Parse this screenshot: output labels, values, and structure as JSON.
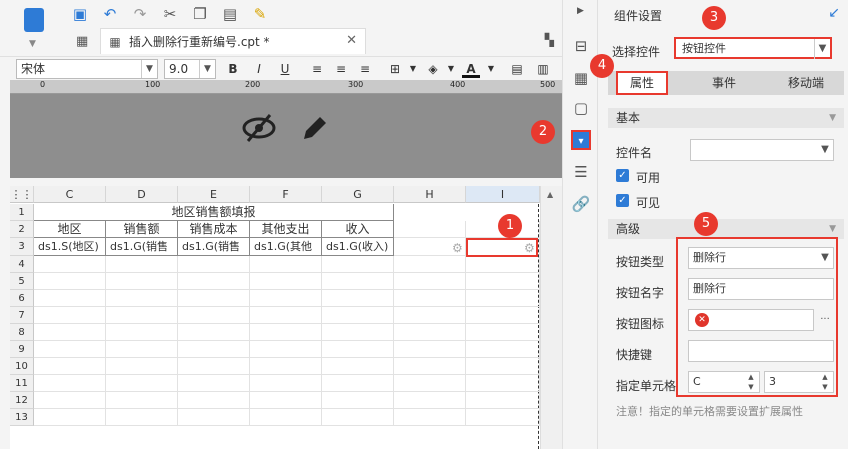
{
  "tab": {
    "filename": "插入删除行重新编号.cpt *"
  },
  "format": {
    "font": "宋体",
    "size": "9.0",
    "bold": "B",
    "italic": "I",
    "underline": "U",
    "font_color_glyph": "A"
  },
  "ruler": {
    "marks": [
      "0",
      "100",
      "200",
      "300",
      "400",
      "500"
    ]
  },
  "grid": {
    "columns": [
      "C",
      "D",
      "E",
      "F",
      "G",
      "H",
      "I"
    ],
    "rows": [
      "1",
      "2",
      "3",
      "4",
      "5",
      "6",
      "7",
      "8",
      "9",
      "10",
      "11",
      "12",
      "13"
    ],
    "title": "地区销售额填报",
    "headers": [
      "地区",
      "销售额",
      "销售成本",
      "其他支出",
      "收入"
    ],
    "data_row": [
      "ds1.S(地区)",
      "ds1.G(销售",
      "ds1.G(销售",
      "ds1.G(其他",
      "ds1.G(收入)"
    ]
  },
  "panel": {
    "title": "组件设置",
    "select_label": "选择控件",
    "select_value": "按钮控件",
    "tabs": [
      "属性",
      "事件",
      "移动端"
    ],
    "basic": {
      "section": "基本",
      "name_label": "控件名",
      "enabled": "可用",
      "visible": "可见"
    },
    "advanced": {
      "section": "高级",
      "type_label": "按钮类型",
      "type_value": "删除行",
      "name_label": "按钮名字",
      "name_value": "删除行",
      "icon_label": "按钮图标",
      "icon_more": "···",
      "shortcut_label": "快捷键",
      "cell_label": "指定单元格",
      "cell_col": "C",
      "cell_row": "3"
    },
    "note": "注意！指定的单元格需要设置扩展属性"
  },
  "badges": [
    "1",
    "2",
    "3",
    "4",
    "5"
  ]
}
